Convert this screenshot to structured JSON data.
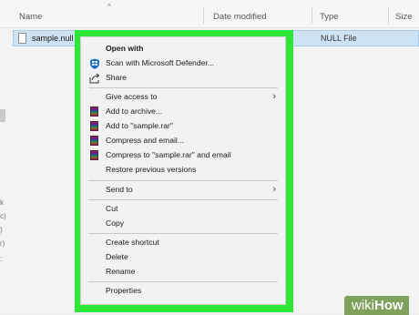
{
  "columns": {
    "name": "Name",
    "date_modified": "Date modified",
    "type": "Type",
    "size": "Size"
  },
  "file": {
    "name": "sample.null",
    "type": "NULL File"
  },
  "context_menu": {
    "open_with": "Open with",
    "scan": "Scan with Microsoft Defender...",
    "share": "Share",
    "give_access": "Give access to",
    "add_archive": "Add to archive...",
    "add_rar": "Add to \"sample.rar\"",
    "compress_email": "Compress and email...",
    "compress_rar_email": "Compress to \"sample.rar\" and email",
    "restore": "Restore previous versions",
    "send_to": "Send to",
    "cut": "Cut",
    "copy": "Copy",
    "create_shortcut": "Create shortcut",
    "delete": "Delete",
    "rename": "Rename",
    "properties": "Properties"
  },
  "watermark": {
    "wiki": "wiki",
    "how": "How"
  },
  "colors": {
    "highlight_frame": "#2ee636",
    "selection": "#cde3f4"
  }
}
